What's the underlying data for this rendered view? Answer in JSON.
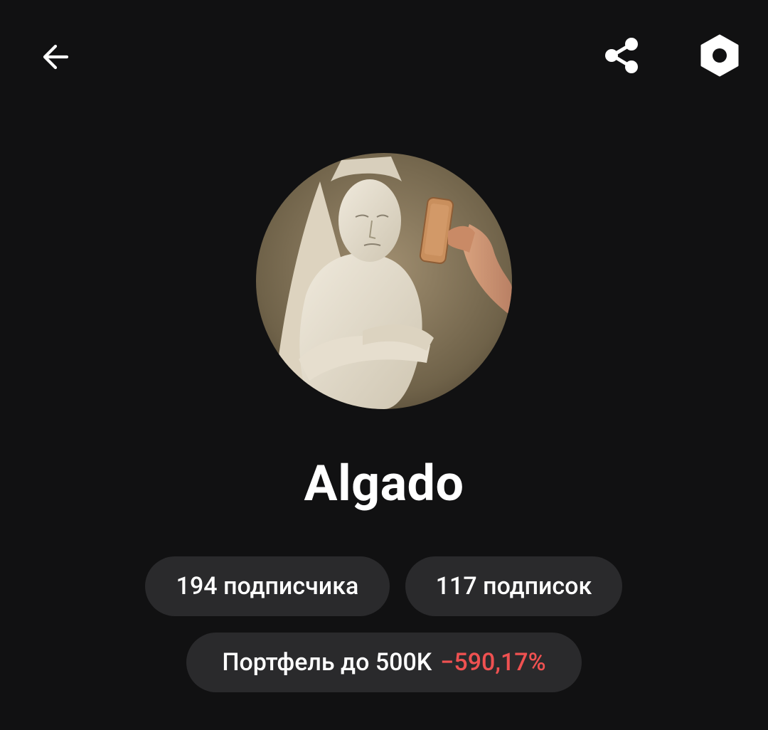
{
  "header": {
    "back_icon": "arrow-left-icon",
    "share_icon": "share-icon",
    "settings_icon": "settings-hexagon-icon"
  },
  "profile": {
    "avatar_alt": "statue-with-phone-avatar",
    "username": "Algado"
  },
  "stats": {
    "followers_label": "194 подписчика",
    "following_label": "117 подписок"
  },
  "portfolio": {
    "label": "Портфель до 500K",
    "return_value": "−590,17%",
    "return_color": "#ef5151"
  },
  "colors": {
    "background": "#111112",
    "chip_background": "#2a2a2c",
    "text": "#ffffff"
  }
}
